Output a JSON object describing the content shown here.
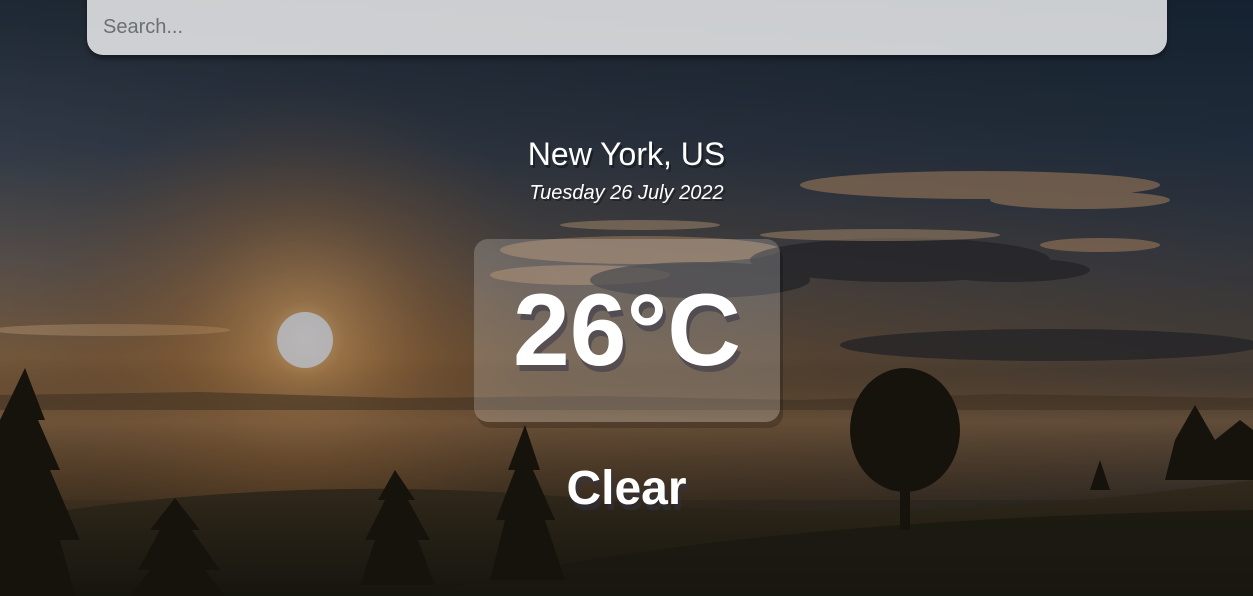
{
  "search": {
    "placeholder": "Search...",
    "value": ""
  },
  "location": {
    "city_country": "New York, US",
    "date": "Tuesday 26 July 2022"
  },
  "weather": {
    "temperature": "26°C",
    "condition": "Clear"
  },
  "background": {
    "scene": "sunrise-over-misty-field-photo",
    "sky_top_color": "#2a3a4e",
    "horizon_color": "#b07a3a"
  }
}
